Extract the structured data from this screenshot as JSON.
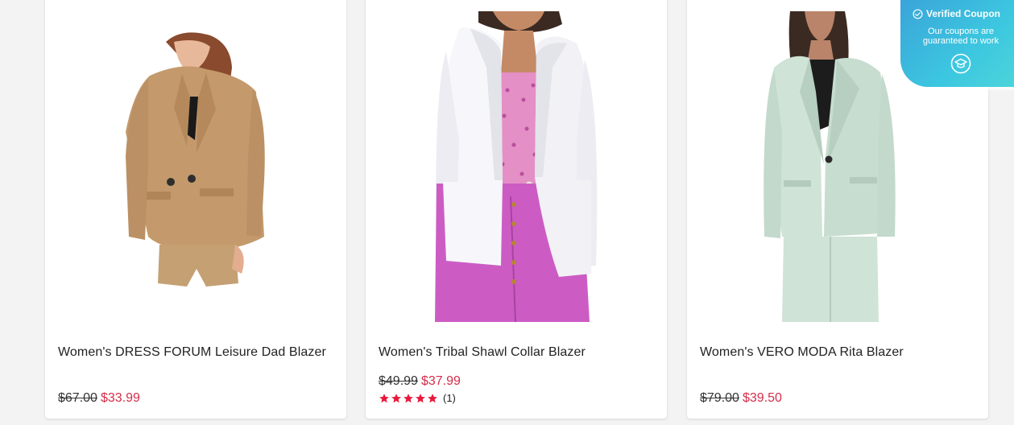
{
  "products": [
    {
      "title": "Women's DRESS FORUM Leisure Dad Blazer",
      "price_old": "$67.00",
      "price_new": "$33.99",
      "image_icon": "tan-linen-blazer-photo"
    },
    {
      "title": "Women's Tribal Shawl Collar Blazer",
      "price_old": "$49.99",
      "price_new": "$37.99",
      "rating_count": "(1)",
      "rating_stars": 5,
      "image_icon": "white-shawl-blazer-photo"
    },
    {
      "title": "Women's VERO MODA Rita Blazer",
      "price_old": "$79.00",
      "price_new": "$39.50",
      "image_icon": "mint-green-blazer-photo"
    }
  ],
  "coupon": {
    "title": "Verified Coupon",
    "line1": "Our coupons are",
    "line2": "guaranteed to work"
  },
  "colors": {
    "sale_price": "#d62d4a",
    "star": "#e8193c",
    "badge_gradient_start": "#3aa0d8",
    "badge_gradient_end": "#4fd6d9"
  }
}
